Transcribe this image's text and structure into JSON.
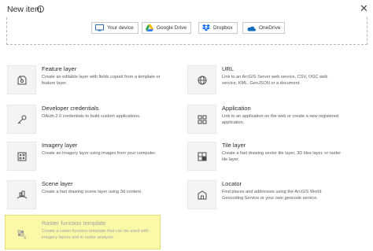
{
  "dialog": {
    "title": "New item"
  },
  "sources": [
    {
      "label": "Your device",
      "icon": "monitor-icon"
    },
    {
      "label": "Google Drive",
      "icon": "google-drive-icon"
    },
    {
      "label": "Dropbox",
      "icon": "dropbox-icon"
    },
    {
      "label": "OneDrive",
      "icon": "onedrive-icon"
    }
  ],
  "items": [
    {
      "name": "Feature layer",
      "description": "Create an editable layer with fields copied from a template or feature layer.",
      "icon": "feature-layer-icon"
    },
    {
      "name": "URL",
      "description": "Link to an ArcGIS Server web service, CSV, OGC web service, KML, GeoJSON or a document.",
      "icon": "globe-icon"
    },
    {
      "name": "Developer credentials",
      "description": "OAuth 2.0 credentials to build custom applications.",
      "icon": "key-icon"
    },
    {
      "name": "Application",
      "description": "Link to an application on the web or create a new registered application.",
      "icon": "application-icon"
    },
    {
      "name": "Imagery layer",
      "description": "Create an imagery layer using images from your computer.",
      "icon": "imagery-layer-icon"
    },
    {
      "name": "Tile layer",
      "description": "Create a fast drawing vector tile layer, 3D tiles layer, or raster tile layer.",
      "icon": "tile-layer-icon"
    },
    {
      "name": "Scene layer",
      "description": "Create a fast drawing scene layer using 3d content.",
      "icon": "scene-layer-icon"
    },
    {
      "name": "Locator",
      "description": "Find places and addresses using the ArcGIS World Geocoding Service or your own geocode service.",
      "icon": "locator-icon"
    },
    {
      "name": "Raster function template",
      "description": "Create a raster function template that can be used with imagery layers and in raster analysis.",
      "icon": "raster-function-icon"
    }
  ],
  "colors": {
    "highlight": "#fbf8a8",
    "google_blue": "#4285f4",
    "dropbox_blue": "#0061fe",
    "onedrive_blue": "#0f6cbd"
  }
}
